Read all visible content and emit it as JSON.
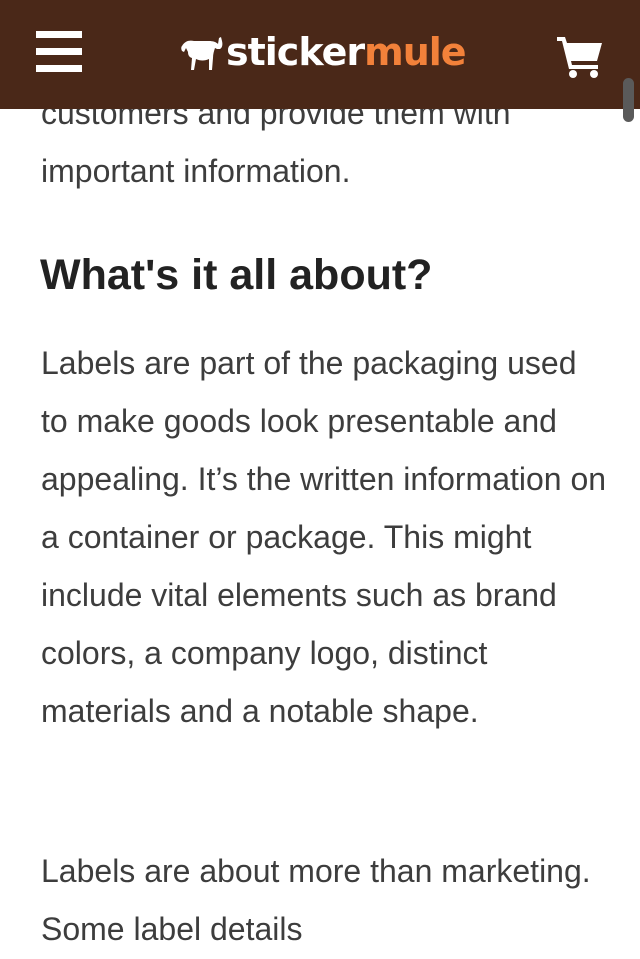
{
  "header": {
    "menu_icon": "hamburger-menu-icon",
    "logo_icon": "mule-icon",
    "logo_text_primary": "sticker",
    "logo_text_accent": "mule",
    "cart_icon": "shopping-cart-icon",
    "colors": {
      "background": "#4a2818",
      "logo_accent": "#f2813a",
      "logo_primary": "#ffffff"
    }
  },
  "article": {
    "intro_partial": "customers and provide them with important information.",
    "heading": "What's it all about?",
    "paragraph_1": "Labels are part of the packaging used to make goods look presentable and appealing. It’s the written information on a container or package. This might include vital elements such as brand colors, a company logo, distinct materials and a notable shape.",
    "paragraph_2": "Labels are about more than marketing. Some label details"
  }
}
